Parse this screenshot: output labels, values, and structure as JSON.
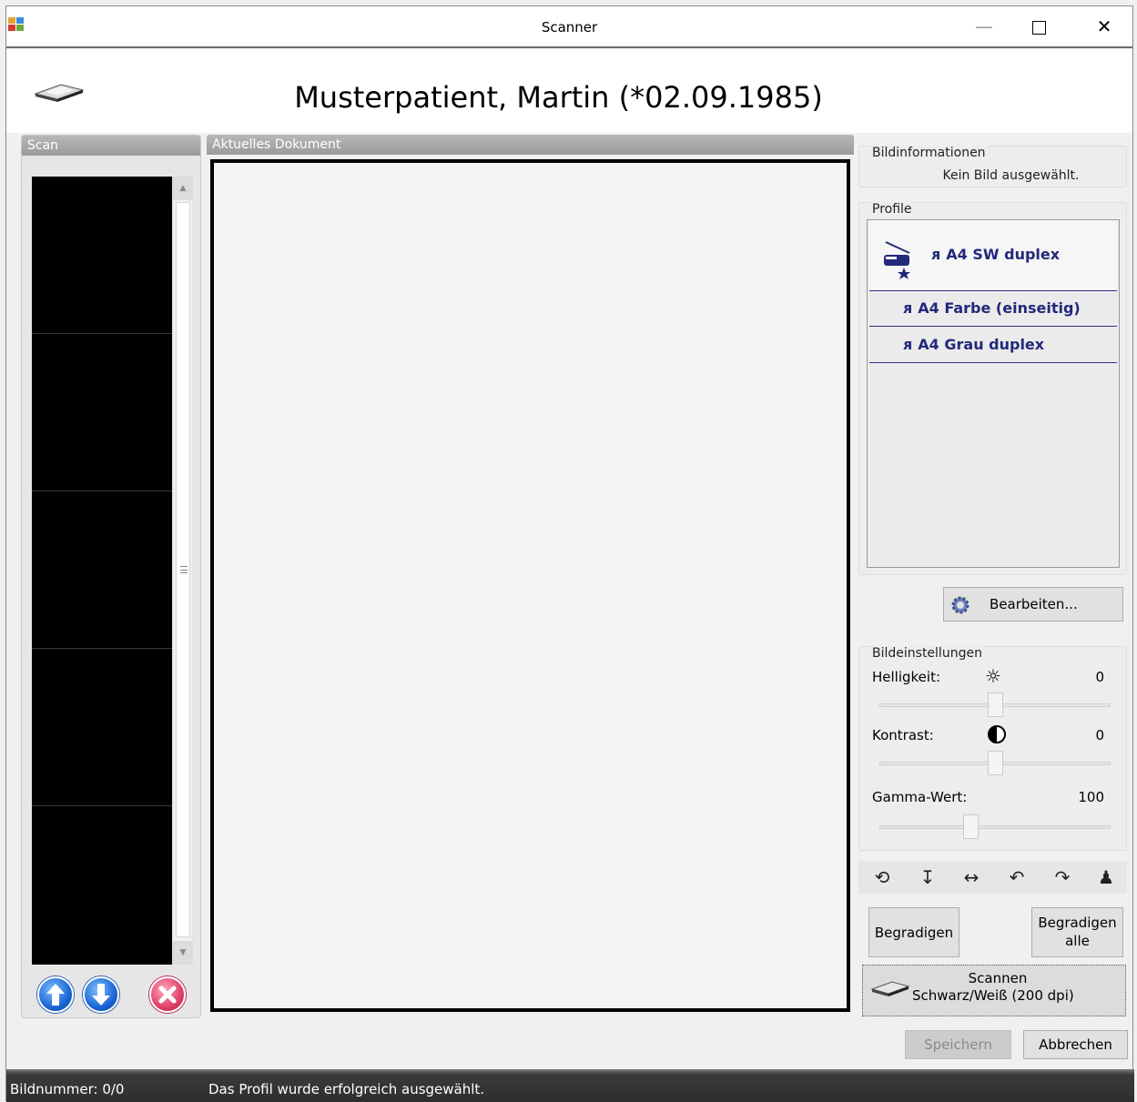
{
  "window": {
    "title": "Scanner"
  },
  "header": {
    "patient": "Musterpatient, Martin (*02.09.1985)"
  },
  "scan_panel": {
    "title": "Scan"
  },
  "document_panel": {
    "title": "Aktuelles Dokument"
  },
  "image_info": {
    "title": "Bildinformationen",
    "text": "Kein Bild ausgewählt."
  },
  "profiles": {
    "title": "Profile",
    "items": [
      {
        "label": "A4 SW duplex",
        "selected": true,
        "default": true
      },
      {
        "label": "A4 Farbe (einseitig)"
      },
      {
        "label": "A4 Grau duplex"
      }
    ],
    "edit_label": "Bearbeiten..."
  },
  "image_settings": {
    "title": "Bildeinstellungen",
    "brightness": {
      "label": "Helligkeit:",
      "value": "0",
      "icon": "sun-icon"
    },
    "contrast": {
      "label": "Kontrast:",
      "value": "0",
      "icon": "contrast-icon"
    },
    "gamma": {
      "label": "Gamma-Wert:",
      "value": "100"
    }
  },
  "tools": [
    "rotate-circle-icon",
    "flip-vertical-icon",
    "flip-horizontal-icon",
    "rotate-left-icon",
    "rotate-right-icon",
    "person-icon"
  ],
  "buttons": {
    "straighten": "Begradigen",
    "straighten_all_line1": "Begradigen",
    "straighten_all_line2": "alle",
    "scan_line1": "Scannen",
    "scan_line2": "Schwarz/Weiß (200 dpi)",
    "save": "Speichern",
    "cancel": "Abbrechen"
  },
  "status": {
    "image_number": "Bildnummer: 0/0",
    "message": "Das Profil wurde erfolgreich ausgewählt."
  },
  "colors": {
    "profile_text": "#22297a",
    "statusbar": "#2e2e2e"
  }
}
